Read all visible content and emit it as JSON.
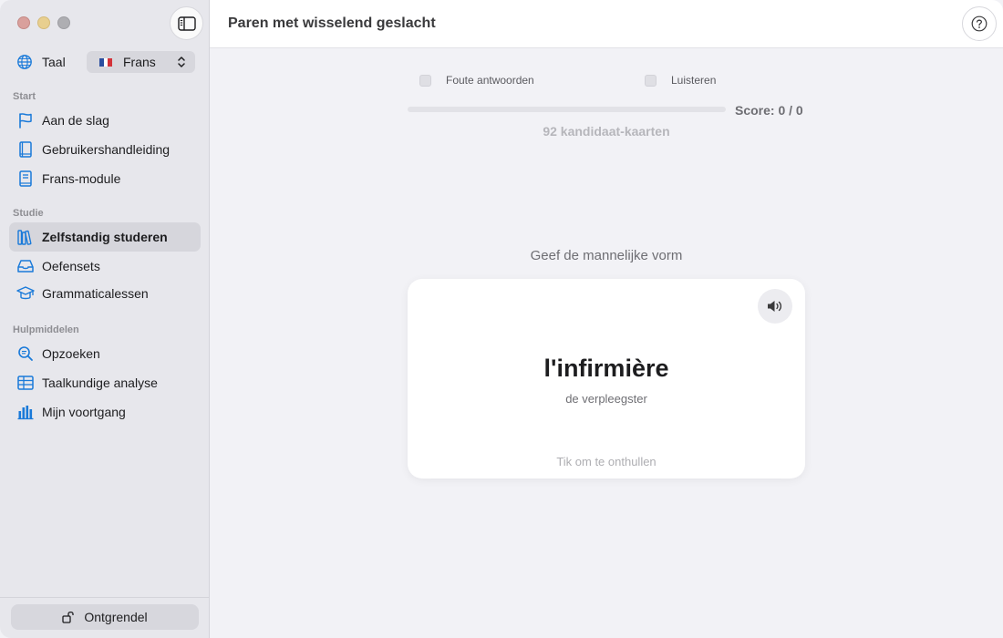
{
  "colors": {
    "accent": "#1a7ad9",
    "sidebar_bg": "#e7e7ec",
    "main_bg": "#f2f2f6"
  },
  "sidebar": {
    "toggle_icon": "sidebar-toggle-icon",
    "language": {
      "label": "Taal",
      "selected": "Frans",
      "flag": "french-flag"
    },
    "sections": [
      {
        "title": "Start",
        "items": [
          {
            "label": "Aan de slag",
            "icon": "flag-icon"
          },
          {
            "label": "Gebruikershandleiding",
            "icon": "book-icon"
          },
          {
            "label": "Frans-module",
            "icon": "module-book-icon"
          }
        ]
      },
      {
        "title": "Studie",
        "items": [
          {
            "label": "Zelfstandig studeren",
            "icon": "books-icon",
            "active": true
          },
          {
            "label": "Oefensets",
            "icon": "tray-icon"
          },
          {
            "label": "Grammaticalessen",
            "icon": "graduation-cap-icon"
          }
        ]
      },
      {
        "title": "Hulpmiddelen",
        "items": [
          {
            "label": "Opzoeken",
            "icon": "search-icon"
          },
          {
            "label": "Taalkundige analyse",
            "icon": "table-icon"
          },
          {
            "label": "Mijn voortgang",
            "icon": "bar-chart-icon"
          }
        ]
      }
    ],
    "unlock_label": "Ontgrendel"
  },
  "header": {
    "title": "Paren met wisselend geslacht",
    "help_icon": "question-mark-icon"
  },
  "main": {
    "options": [
      {
        "label": "Foute antwoorden",
        "checked": false
      },
      {
        "label": "Luisteren",
        "checked": false
      }
    ],
    "progress": 0,
    "score": "Score: 0 / 0",
    "candidates": "92 kandidaat-kaarten",
    "prompt": "Geef de mannelijke vorm",
    "card": {
      "word": "l'infirmière",
      "translation": "de verpleegster",
      "hint": "Tik om te onthullen",
      "speaker_icon": "speaker-icon"
    }
  }
}
